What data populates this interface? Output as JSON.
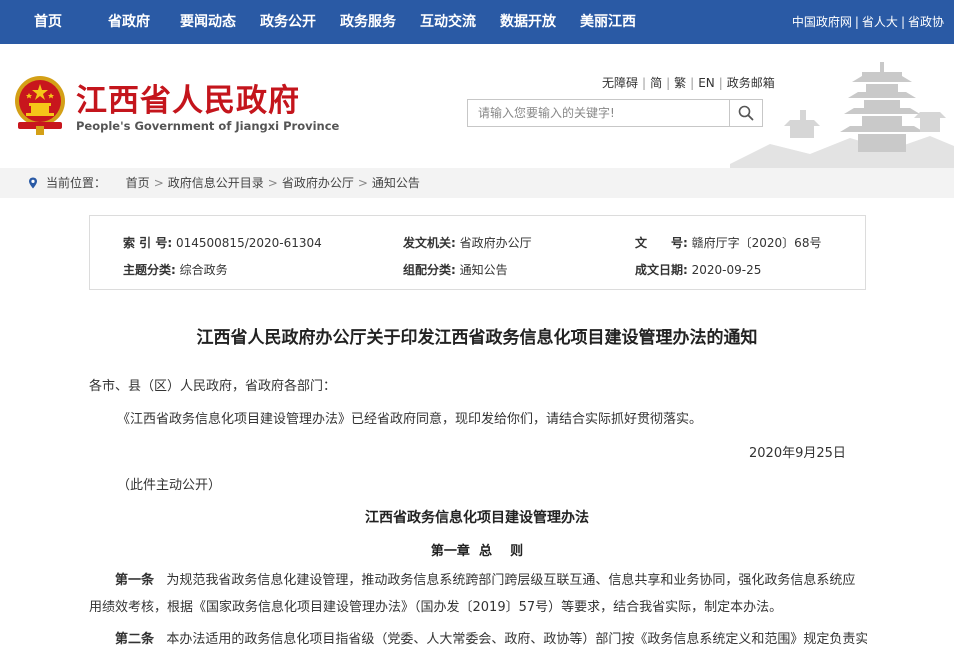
{
  "topnav": {
    "items": [
      "首页",
      "省政府",
      "要闻动态",
      "政务公开",
      "政务服务",
      "互动交流",
      "数据开放",
      "美丽江西"
    ],
    "external_links": [
      "中国政府网",
      "省人大",
      "省政协"
    ]
  },
  "header": {
    "site_title": "江西省人民政府",
    "site_subtitle": "People's Government of Jiangxi Province",
    "util_links": [
      "无障碍",
      "简",
      "繁",
      "EN",
      "政务邮箱"
    ],
    "search_placeholder": "请输入您要输入的关键字!"
  },
  "breadcrumb": {
    "label": "当前位置：",
    "items": [
      "首页",
      "政府信息公开目录",
      "省政府办公厅",
      "通知公告"
    ]
  },
  "meta": {
    "index_no_label": "索 引 号:",
    "index_no": "014500815/2020-61304",
    "issuer_label": "发文机关:",
    "issuer": "省政府办公厅",
    "doc_no_label": "文　　号:",
    "doc_no": "赣府厅字〔2020〕68号",
    "topic_label": "主题分类:",
    "topic": "综合政务",
    "category_label": "组配分类:",
    "category": "通知公告",
    "date_label": "成文日期:",
    "date": "2020-09-25"
  },
  "document": {
    "title": "江西省人民政府办公厅关于印发江西省政务信息化项目建设管理办法的通知",
    "recipients": "各市、县（区）人民政府，省政府各部门：",
    "body": "《江西省政务信息化项目建设管理办法》已经省政府同意，现印发给你们，请结合实际抓好贯彻落实。",
    "signed_date": "2020年9月25日",
    "disclosure": "（此件主动公开）",
    "measures_title": "江西省政务信息化项目建设管理办法",
    "chapter1": "第一章  总    则",
    "article1_no": "第一条",
    "article1_text": "为规范我省政务信息化建设管理，推动政务信息系统跨部门跨层级互联互通、信息共享和业务协同，强化政务信息系统应用绩效考核，根据《国家政务信息化项目建设管理办法》（国办发〔2019〕57号）等要求，结合我省实际，制定本办法。",
    "article2_no": "第二条",
    "article2_text": "本办法适用的政务信息化项目指省级（党委、人大常委会、政府、政协等）部门按《政务信息系统定义和范围》规定负责实"
  },
  "colors": {
    "nav_bg": "#2a5aa5",
    "title_red": "#c4151c",
    "breadcrumb_bg": "#f3f3f3"
  },
  "icons": {
    "emblem": "national-emblem-icon",
    "search": "magnifier-icon",
    "location": "location-pin-icon"
  }
}
